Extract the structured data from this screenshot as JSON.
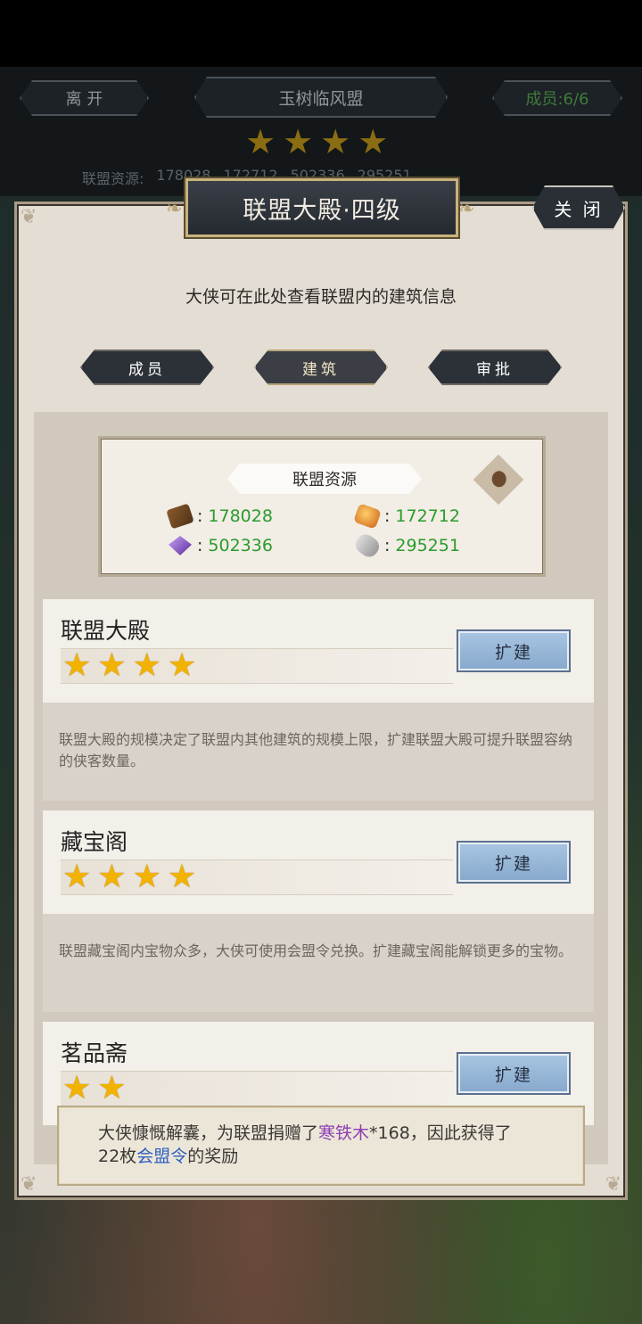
{
  "header": {
    "leave_label": "离 开",
    "alliance_name": "玉树临风盟",
    "members_label": "成员:6/6",
    "stars": 4,
    "resources_label": "联盟资源:",
    "res_values": [
      "178028",
      "172712",
      "502336",
      "295251"
    ]
  },
  "panel": {
    "title": "联盟大殿·四级",
    "close_label": "关 闭",
    "subtitle": "大侠可在此处查看联盟内的建筑信息",
    "tabs": [
      {
        "label": "成员",
        "active": false
      },
      {
        "label": "建筑",
        "active": true
      },
      {
        "label": "审批",
        "active": false
      }
    ]
  },
  "resource_card": {
    "title": "联盟资源",
    "items": [
      {
        "icon": "wood-icon",
        "sep": ":",
        "value": "178028"
      },
      {
        "icon": "coin-icon",
        "sep": ":",
        "value": "172712"
      },
      {
        "icon": "gem-icon",
        "sep": ":",
        "value": "502336"
      },
      {
        "icon": "scroll-icon",
        "sep": ":",
        "value": "295251"
      }
    ]
  },
  "buildings": [
    {
      "name": "联盟大殿",
      "stars": 4,
      "button": "扩建",
      "desc": "联盟大殿的规模决定了联盟内其他建筑的规模上限，扩建联盟大殿可提升联盟容纳的侠客数量。"
    },
    {
      "name": "藏宝阁",
      "stars": 4,
      "button": "扩建",
      "desc": "联盟藏宝阁内宝物众多，大侠可使用会盟令兑换。扩建藏宝阁能解锁更多的宝物。"
    },
    {
      "name": "茗品斋",
      "stars": 2,
      "button": "扩建",
      "desc": ""
    }
  ],
  "toast": {
    "part1": "大侠慷慨解囊，为联盟捐赠了",
    "item": "寒铁木",
    "part2": "*168，因此获得了",
    "part3": "22枚",
    "reward": "会盟令",
    "part4": "的奖励"
  },
  "colors": {
    "value_green": "#2b9b2b",
    "star_gold": "#f2b200",
    "expand_blue": "#86a8cc",
    "toast_purple": "#8e3fb3",
    "toast_blue": "#2f5fbf"
  }
}
